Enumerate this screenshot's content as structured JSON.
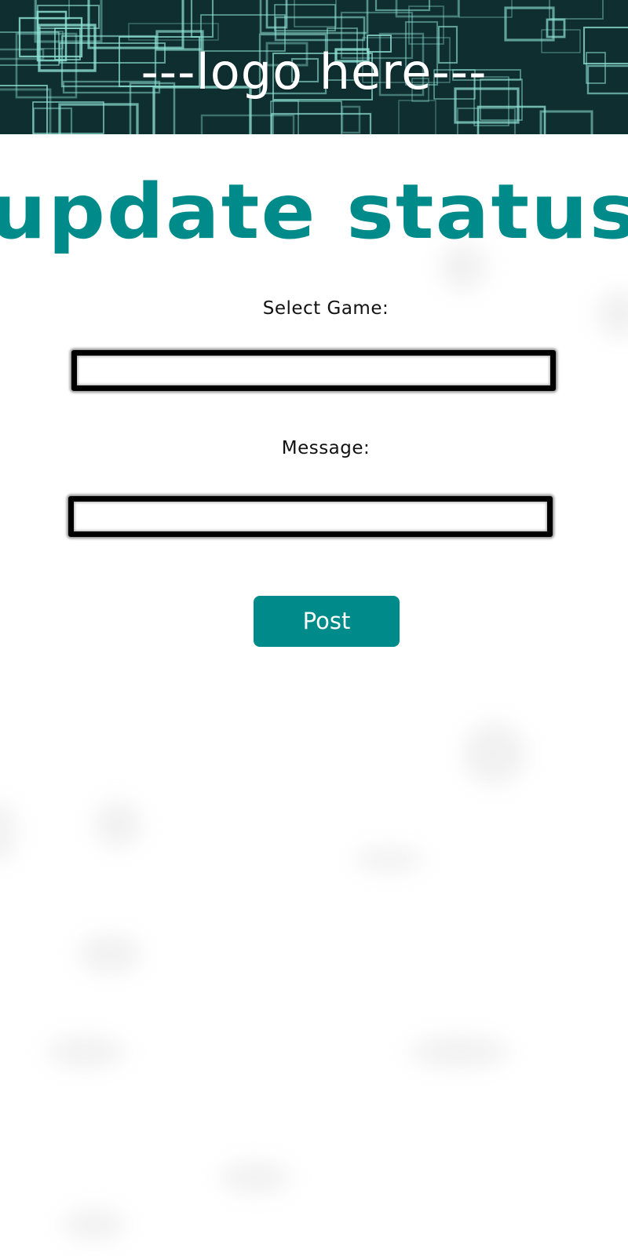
{
  "header": {
    "logo_text": "---logo here---"
  },
  "main": {
    "title": "update status",
    "select_game_label": "Select Game:",
    "select_game_value": "",
    "message_label": "Message:",
    "message_value": "",
    "post_label": "Post"
  },
  "colors": {
    "accent": "#008b8b",
    "header_bg": "#0f2e30",
    "circuit_lines": "#8fe3d6"
  }
}
